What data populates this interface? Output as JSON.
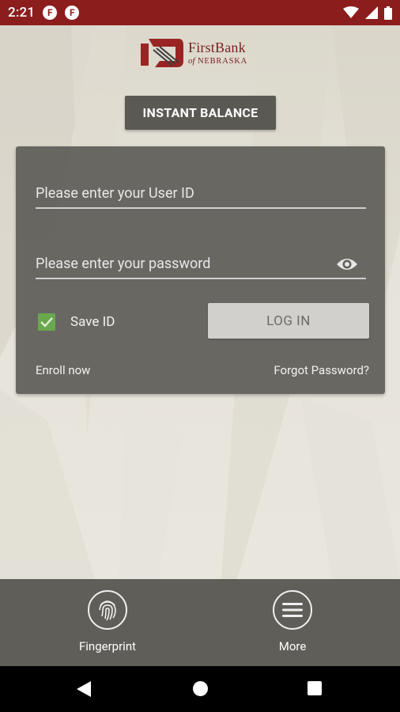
{
  "status_bar": {
    "time": "2:21",
    "icons": [
      "app-notification-icon",
      "app-notification-icon",
      "wifi-icon",
      "signal-icon",
      "battery-icon"
    ],
    "app_icon_glyph": "F",
    "background": "#8c1d1d"
  },
  "logo": {
    "line1": "FirstBank",
    "line2_italic": "of",
    "line2": "NEBRASKA",
    "color": "#7a1f1f"
  },
  "instant_balance": {
    "label": "INSTANT BALANCE"
  },
  "login": {
    "user_id_placeholder": "Please enter your User ID",
    "password_placeholder": "Please enter your password",
    "save_id_label": "Save ID",
    "save_id_checked": true,
    "login_label": "LOG IN",
    "enroll_label": "Enroll now",
    "forgot_label": "Forgot Password?"
  },
  "bottom_nav": {
    "fingerprint_label": "Fingerprint",
    "more_label": "More"
  },
  "colors": {
    "accent_green": "#6aa84f",
    "card": "#5f5e58",
    "brand_red": "#8c1d1d"
  }
}
